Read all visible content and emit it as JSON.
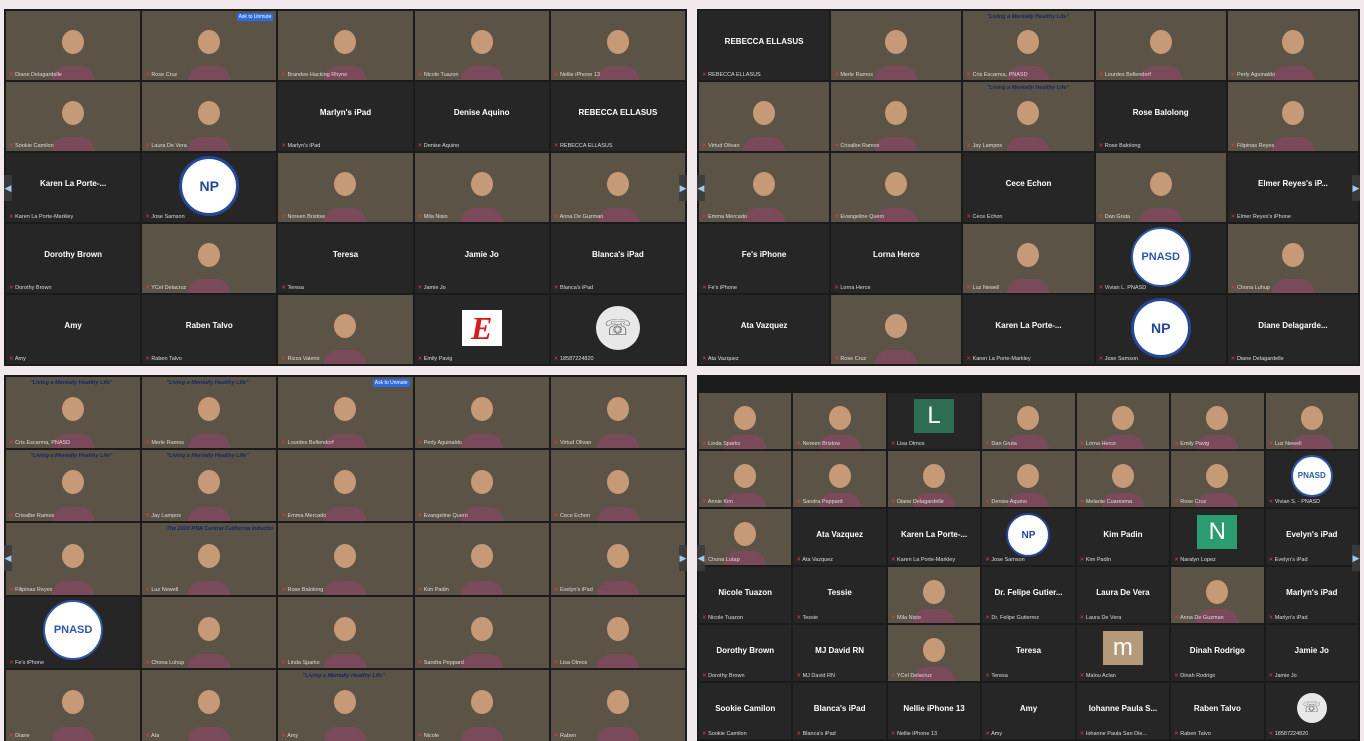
{
  "screenshot": {
    "panels": [
      {
        "id": "top-left",
        "cols": 5,
        "tiles": [
          {
            "k": "video",
            "bg": "room",
            "name": "Diane Delagardelle"
          },
          {
            "k": "video",
            "bg": "sky",
            "name": "Rose Cruz",
            "badge": "Ask to Unmute"
          },
          {
            "k": "video",
            "bg": "room",
            "name": "Brandee Hacking Rhyne"
          },
          {
            "k": "video",
            "bg": "room",
            "name": "Nicole Tuazon"
          },
          {
            "k": "video",
            "bg": "dark",
            "name": "Nellie iPhone 13"
          },
          {
            "k": "video",
            "bg": "room",
            "name": "Sookie Camilon"
          },
          {
            "k": "video",
            "bg": "room",
            "name": "Laura De Vera"
          },
          {
            "k": "text",
            "big": "Marlyn's iPad",
            "name": "Marlyn's iPad"
          },
          {
            "k": "text",
            "big": "Denise Aquino",
            "name": "Denise Aquino"
          },
          {
            "k": "text",
            "big": "REBECCA ELLASUS",
            "name": "REBECCA ELLASUS"
          },
          {
            "k": "text",
            "big": "Karen La Porte-...",
            "name": "Karen La Porte-Markley"
          },
          {
            "k": "np",
            "name": "Jose Samson"
          },
          {
            "k": "video",
            "bg": "room",
            "name": "Noreen Bristow"
          },
          {
            "k": "video",
            "bg": "pink",
            "name": "Mila Nisio"
          },
          {
            "k": "video",
            "bg": "sky",
            "name": "Anna De Guzman"
          },
          {
            "k": "text",
            "big": "Dorothy Brown",
            "name": "Dorothy Brown"
          },
          {
            "k": "video",
            "bg": "room",
            "name": "YCel Delacruz"
          },
          {
            "k": "text",
            "big": "Teresa",
            "name": "Teresa"
          },
          {
            "k": "text",
            "big": "Jamie Jo",
            "name": "Jamie Jo"
          },
          {
            "k": "text",
            "big": "Blanca's iPad",
            "name": "Blanca's iPad"
          },
          {
            "k": "text",
            "big": "Amy",
            "name": "Amy"
          },
          {
            "k": "text",
            "big": "Raben Talvo",
            "name": "Raben Talvo"
          },
          {
            "k": "video",
            "bg": "sky",
            "name": "Rizza Valerio"
          },
          {
            "k": "logoE",
            "name": "Emily Pavig"
          },
          {
            "k": "phone",
            "name": "18587224820"
          }
        ]
      },
      {
        "id": "top-right",
        "cols": 5,
        "tiles": [
          {
            "k": "text",
            "big": "REBECCA ELLASUS",
            "name": "REBECCA ELLASUS"
          },
          {
            "k": "video",
            "bg": "room",
            "name": "Merle Ramos"
          },
          {
            "k": "video",
            "bg": "sky",
            "name": "Cris Escarma, PNASD",
            "banner": "\"Living a Mentally Healthy Life\""
          },
          {
            "k": "video",
            "bg": "room",
            "name": "Lourdes Bellendorf"
          },
          {
            "k": "video",
            "bg": "room",
            "name": "Perly Aguinaldo"
          },
          {
            "k": "video",
            "bg": "room",
            "name": "Virtud Olivan"
          },
          {
            "k": "video",
            "bg": "room",
            "name": "Crisalbe Ramos"
          },
          {
            "k": "video",
            "bg": "sky",
            "name": "Jay Lampos",
            "banner": "\"Living a Mentally Healthy Life\""
          },
          {
            "k": "text",
            "big": "Rose Balolong",
            "name": "Rose Balolong"
          },
          {
            "k": "video",
            "bg": "room",
            "name": "Filipinas Reyes"
          },
          {
            "k": "video",
            "bg": "pink",
            "name": "Emma Mercado"
          },
          {
            "k": "video",
            "bg": "dark",
            "name": "Evangeline Quero"
          },
          {
            "k": "text",
            "big": "Cece Echon",
            "name": "Cece Echon"
          },
          {
            "k": "video",
            "bg": "sky",
            "name": "Dan Gruta"
          },
          {
            "k": "text",
            "big": "Elmer Reyes's iP...",
            "name": "Elmer Reyes's iPhone"
          },
          {
            "k": "text",
            "big": "Fe's iPhone",
            "name": "Fe's iPhone"
          },
          {
            "k": "text",
            "big": "Lorna Herce",
            "name": "Lorna Herce"
          },
          {
            "k": "video",
            "bg": "room",
            "name": "Luz Newell"
          },
          {
            "k": "pnasd",
            "name": "Vivian L. PNASD"
          },
          {
            "k": "video",
            "bg": "pink",
            "name": "Chona Luhup"
          },
          {
            "k": "text",
            "big": "Ata Vazquez",
            "name": "Ata Vazquez"
          },
          {
            "k": "video",
            "bg": "dark",
            "name": "Rose Cruz"
          },
          {
            "k": "text",
            "big": "Karen La Porte-...",
            "name": "Karen La Porte-Markley"
          },
          {
            "k": "np",
            "name": "Jose Samson"
          },
          {
            "k": "text",
            "big": "Diane Delagarde...",
            "name": "Diane Delagardelle"
          }
        ]
      },
      {
        "id": "bottom-left",
        "cols": 5,
        "tiles": [
          {
            "k": "video",
            "bg": "sky",
            "name": "Cris Escarma, PNASD",
            "banner": "\"Living a Mentally Healthy Life\""
          },
          {
            "k": "video",
            "bg": "sky",
            "name": "Merle Ramos",
            "banner": "\"Living a Mentally Healthy Life\""
          },
          {
            "k": "video",
            "bg": "room",
            "name": "Lourdes Bellendorf",
            "badge": "Ask to Unmute"
          },
          {
            "k": "video",
            "bg": "room",
            "name": "Perly Aguinaldo"
          },
          {
            "k": "video",
            "bg": "room",
            "name": "Virtud Olivan"
          },
          {
            "k": "video",
            "bg": "sky",
            "name": "Crisalbe Ramos",
            "banner": "\"Living a Mentally Healthy Life\""
          },
          {
            "k": "video",
            "bg": "sky",
            "name": "Jay Lampos",
            "banner": "\"Living a Mentally Healthy Life\""
          },
          {
            "k": "video",
            "bg": "pink",
            "name": "Emma Mercado"
          },
          {
            "k": "video",
            "bg": "dark",
            "name": "Evangeline Quero"
          },
          {
            "k": "video",
            "bg": "sky",
            "name": "Cece Echon"
          },
          {
            "k": "video",
            "bg": "room",
            "name": "Filipinas Reyes"
          },
          {
            "k": "video",
            "bg": "pink",
            "name": "Luz Newell",
            "banner": "The 2020 PNA Central California Induction Ceremony"
          },
          {
            "k": "video",
            "bg": "room",
            "name": "Rose Balolong"
          },
          {
            "k": "video",
            "bg": "room",
            "name": "Kim Padin"
          },
          {
            "k": "video",
            "bg": "dark",
            "name": "Evelyn's iPad"
          },
          {
            "k": "pnasd",
            "name": "Fe's iPhone"
          },
          {
            "k": "video",
            "bg": "room",
            "name": "Chona Luhup"
          },
          {
            "k": "video",
            "bg": "room",
            "name": "Linda Sparks"
          },
          {
            "k": "video",
            "bg": "room",
            "name": "Sandra Peppard"
          },
          {
            "k": "video",
            "bg": "room",
            "name": "Lisa Olmos"
          },
          {
            "k": "video",
            "bg": "room",
            "name": "Diane"
          },
          {
            "k": "video",
            "bg": "room",
            "name": "Ata"
          },
          {
            "k": "video",
            "bg": "sky",
            "name": "Amy",
            "banner": "\"Living a Mentally Healthy Life\""
          },
          {
            "k": "video",
            "bg": "room",
            "name": "Nicole"
          },
          {
            "k": "video",
            "bg": "room",
            "name": "Raben"
          }
        ]
      },
      {
        "id": "bottom-right",
        "cols": 7,
        "tiles": [
          {
            "k": "video",
            "bg": "room",
            "name": "Linda Sparks"
          },
          {
            "k": "video",
            "bg": "room",
            "name": "Noreen Bristow"
          },
          {
            "k": "letter",
            "letter": "L",
            "color": "#2f6d52",
            "name": "Lisa Olmos"
          },
          {
            "k": "video",
            "bg": "sky",
            "name": "Dan Gruta"
          },
          {
            "k": "video",
            "bg": "room",
            "name": "Lorna Herce"
          },
          {
            "k": "video",
            "bg": "room",
            "name": "Emily Pavig"
          },
          {
            "k": "video",
            "bg": "pink",
            "name": "Luz Newell"
          },
          {
            "k": "video",
            "bg": "room",
            "name": "Annie Kim"
          },
          {
            "k": "video",
            "bg": "room",
            "name": "Sandra Peppard"
          },
          {
            "k": "video",
            "bg": "room",
            "name": "Diane Delagardelle"
          },
          {
            "k": "video",
            "bg": "room",
            "name": "Denise Aquino"
          },
          {
            "k": "video",
            "bg": "room",
            "name": "Melanie Cuaresma"
          },
          {
            "k": "video",
            "bg": "dark",
            "name": "Rose Cruz"
          },
          {
            "k": "pnasd",
            "name": "Vivian S. - PNASD"
          },
          {
            "k": "video",
            "bg": "pink",
            "name": "Chona Lutap"
          },
          {
            "k": "text",
            "big": "Ata Vazquez",
            "name": "Ata Vazquez"
          },
          {
            "k": "text",
            "big": "Karen La Porte-...",
            "name": "Karen La Porte-Markley"
          },
          {
            "k": "np",
            "name": "Jose Samson"
          },
          {
            "k": "text",
            "big": "Kim Padin",
            "name": "Kim Padin"
          },
          {
            "k": "letter",
            "letter": "N",
            "color": "#2a9d70",
            "name": "Naralyn Lopez"
          },
          {
            "k": "text",
            "big": "Evelyn's iPad",
            "name": "Evelyn's iPad"
          },
          {
            "k": "text",
            "big": "Nicole Tuazon",
            "name": "Nicole Tuazon"
          },
          {
            "k": "text",
            "big": "Tessie",
            "name": "Tessie"
          },
          {
            "k": "video",
            "bg": "pink",
            "name": "Mila Nisio"
          },
          {
            "k": "text",
            "big": "Dr. Felipe Gutier...",
            "name": "Dr. Felipe Gutierrez"
          },
          {
            "k": "text",
            "big": "Laura De Vera",
            "name": "Laura De Vera"
          },
          {
            "k": "video",
            "bg": "sky",
            "name": "Anna De Guzman"
          },
          {
            "k": "text",
            "big": "Marlyn's iPad",
            "name": "Marlyn's iPad"
          },
          {
            "k": "text",
            "big": "Dorothy Brown",
            "name": "Dorothy Brown"
          },
          {
            "k": "text",
            "big": "MJ David RN",
            "name": "MJ David RN"
          },
          {
            "k": "video",
            "bg": "room",
            "name": "YCel Delacruz"
          },
          {
            "k": "text",
            "big": "Teresa",
            "name": "Teresa"
          },
          {
            "k": "letter",
            "letter": "m",
            "color": "#b59a7a",
            "name": "Malou Aclan"
          },
          {
            "k": "text",
            "big": "Dinah Rodrigo",
            "name": "Dinah Rodrigo"
          },
          {
            "k": "text",
            "big": "Jamie Jo",
            "name": "Jamie Jo"
          },
          {
            "k": "text",
            "big": "Sookie Camilon",
            "name": "Sookie Camilon"
          },
          {
            "k": "text",
            "big": "Blanca's iPad",
            "name": "Blanca's iPad"
          },
          {
            "k": "text",
            "big": "Nellie iPhone 13",
            "name": "Nellie iPhone 13"
          },
          {
            "k": "text",
            "big": "Amy",
            "name": "Amy"
          },
          {
            "k": "text",
            "big": "Iohanne Paula S...",
            "name": "Iohanne Paula San Die..."
          },
          {
            "k": "text",
            "big": "Raben Talvo",
            "name": "Raben Talvo"
          },
          {
            "k": "phone",
            "name": "18587224820"
          }
        ]
      }
    ]
  }
}
